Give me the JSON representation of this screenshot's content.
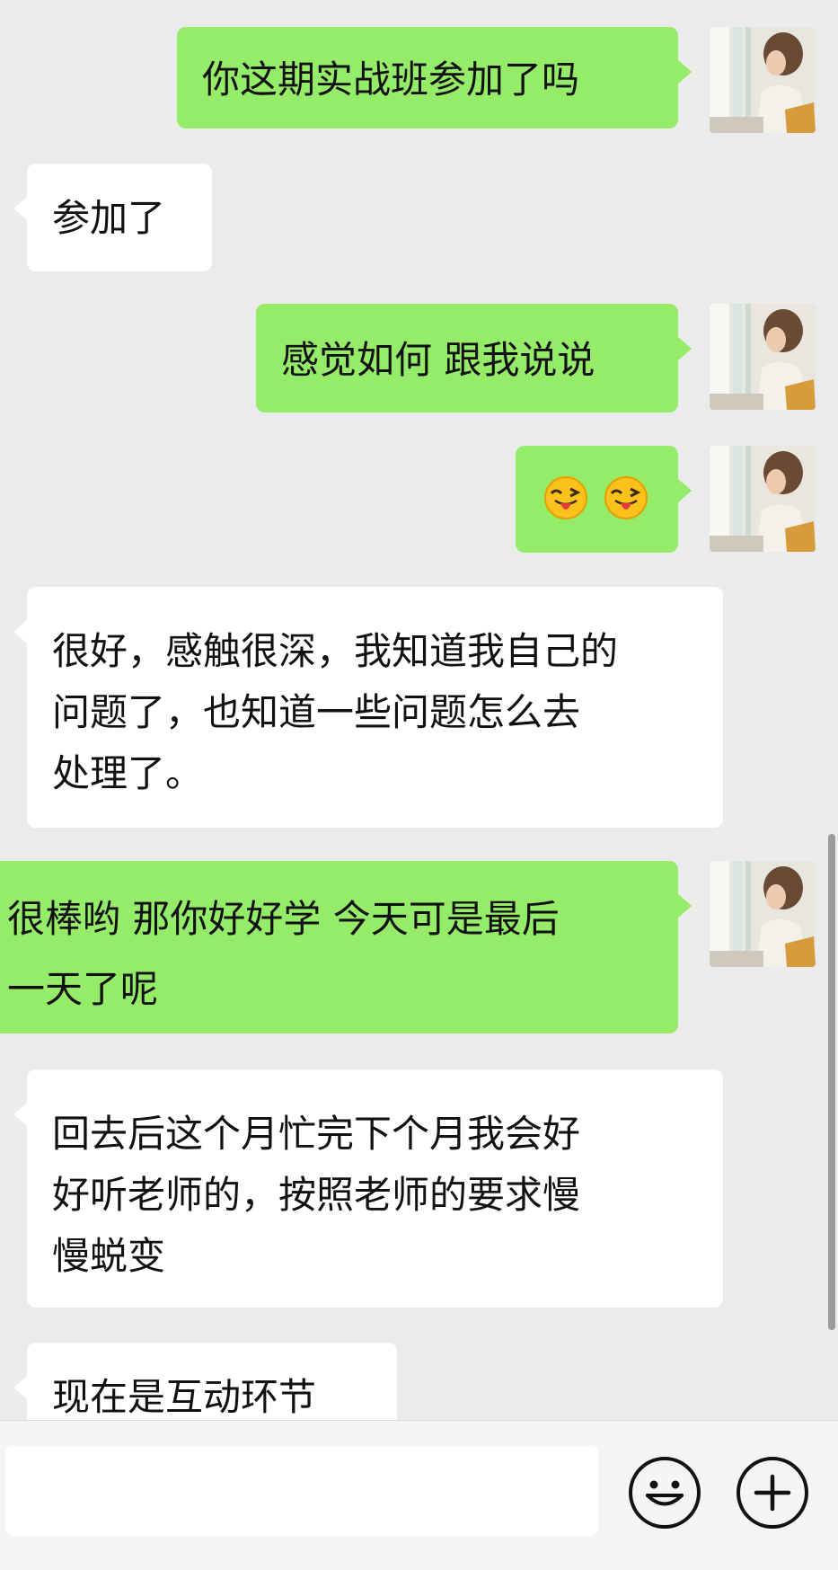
{
  "messages": [
    {
      "from": "me",
      "text": "你这期实战班参加了吗"
    },
    {
      "from": "them",
      "text": "参加了"
    },
    {
      "from": "me",
      "text": "感觉如何 跟我说说"
    },
    {
      "from": "me",
      "emoji": "wink-tongue-emoji",
      "count": 2
    },
    {
      "from": "them",
      "lines": [
        "很好，感触很深，我知道我自己的",
        "问题了，也知道一些问题怎么去",
        "处理了。"
      ]
    },
    {
      "from": "me",
      "lines": [
        "很棒哟 那你好好学 今天可是最后",
        "一天了呢"
      ]
    },
    {
      "from": "them",
      "lines": [
        "回去后这个月忙完下个月我会好",
        "好听老师的，按照老师的要求慢",
        "慢蜕变"
      ]
    },
    {
      "from": "them",
      "text": "现在是互动环节"
    }
  ],
  "composer": {
    "input_value": "",
    "emoji_button": "smiley-icon",
    "more_button": "plus-icon"
  },
  "colors": {
    "background": "#ebebeb",
    "sent_bubble": "#95ec69",
    "received_bubble": "#ffffff"
  }
}
